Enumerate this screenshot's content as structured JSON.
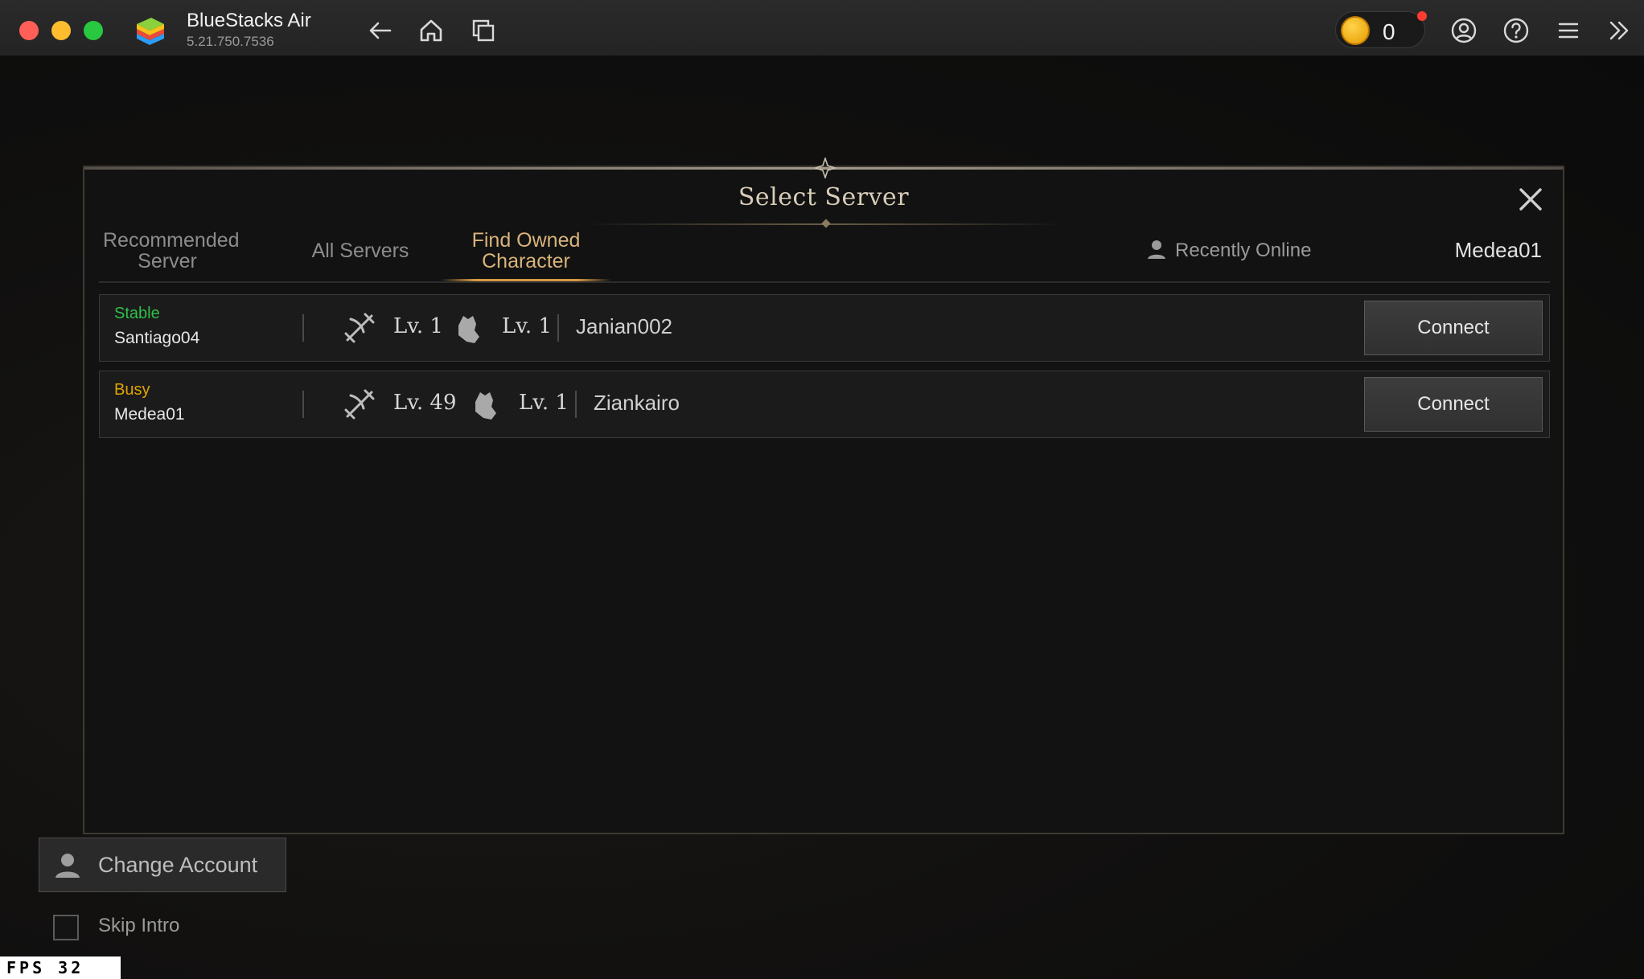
{
  "window": {
    "app_name": "BlueStacks Air",
    "app_version": "5.21.750.7536",
    "coin_count": "0",
    "icons": [
      "back-arrow-icon",
      "home-icon",
      "multi-instance-icon",
      "account-icon",
      "help-icon",
      "menu-icon",
      "expand-sidebar-icon"
    ]
  },
  "dialog": {
    "title": "Select Server",
    "tabs": [
      {
        "label": "Recommended Server",
        "line1": "Recommended",
        "line2": "Server",
        "active": false
      },
      {
        "label": "All Servers",
        "active": false
      },
      {
        "label": "Find Owned Character",
        "line1": "Find Owned",
        "line2": "Character",
        "active": true
      }
    ],
    "recently_online_label": "Recently Online",
    "current_server": "Medea01",
    "rows": [
      {
        "status": "Stable",
        "status_color": "#2fbf4a",
        "server": "Santiago04",
        "class1_level": "Lv. 1",
        "class2_level": "Lv. 1",
        "character": "Janian002",
        "button": "Connect"
      },
      {
        "status": "Busy",
        "status_color": "#e0a400",
        "server": "Medea01",
        "class1_level": "Lv. 49",
        "class2_level": "Lv. 1",
        "character": "Ziankairo",
        "button": "Connect"
      }
    ]
  },
  "bottom": {
    "change_account": "Change Account",
    "skip_intro": "Skip Intro",
    "skip_intro_checked": false
  },
  "fps": {
    "label": "FPS",
    "value": "32",
    "text": "FPS  32"
  }
}
